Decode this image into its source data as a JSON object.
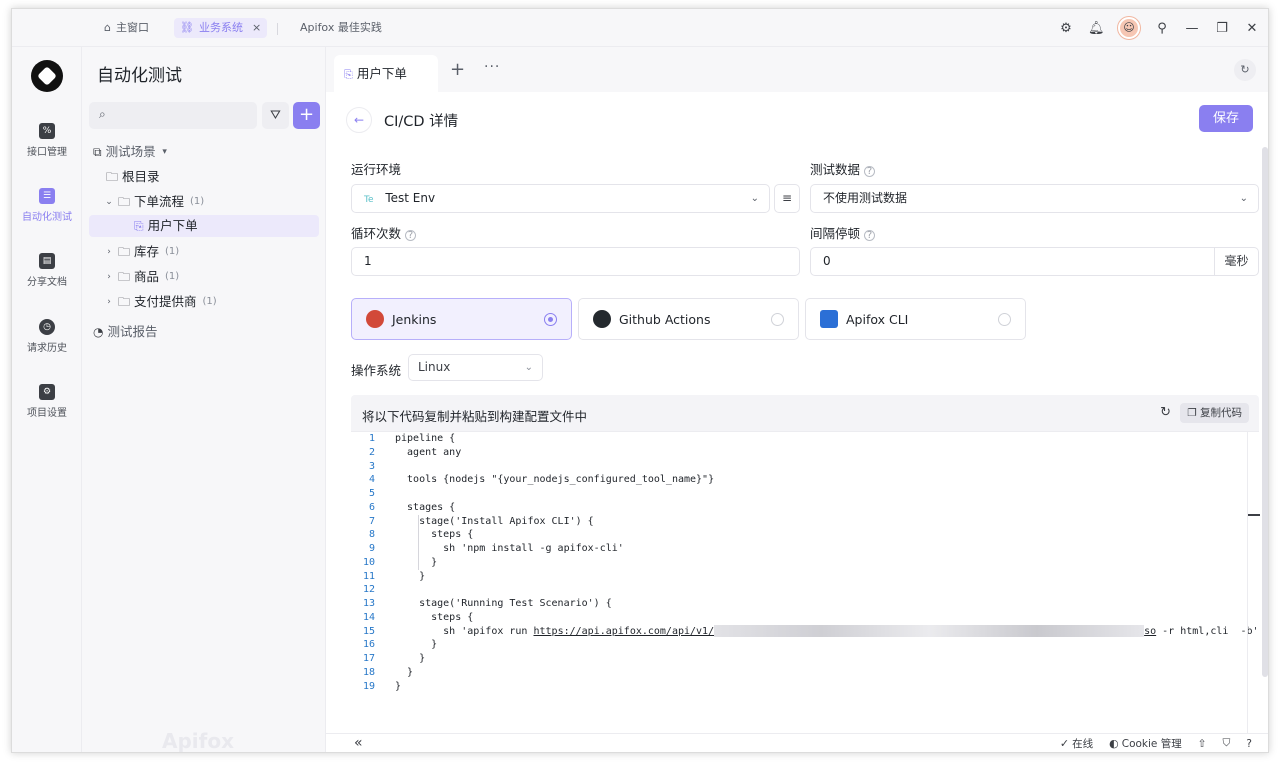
{
  "titlebar": {
    "tabs": [
      {
        "label": "主窗口",
        "icon": "home-icon"
      },
      {
        "label": "业务系统",
        "icon": "link-icon",
        "active": true
      },
      {
        "label": "Apifox 最佳实践",
        "icon": ""
      }
    ],
    "close_glyph": "×"
  },
  "rail": {
    "items": [
      {
        "label": "接口管理",
        "icon": "api-icon"
      },
      {
        "label": "自动化测试",
        "icon": "automation-icon",
        "active": true
      },
      {
        "label": "分享文档",
        "icon": "docs-icon"
      },
      {
        "label": "请求历史",
        "icon": "history-icon"
      },
      {
        "label": "项目设置",
        "icon": "settings-icon"
      }
    ]
  },
  "tree": {
    "title": "自动化测试",
    "search_placeholder": "",
    "root_label": "测试场景",
    "nodes": {
      "root": "根目录",
      "order_flow": {
        "label": "下单流程",
        "count": "(1)"
      },
      "user_order": "用户下单",
      "stock": {
        "label": "库存",
        "count": "(1)"
      },
      "goods": {
        "label": "商品",
        "count": "(1)"
      },
      "payment": {
        "label": "支付提供商",
        "count": "(1)"
      }
    },
    "report_label": "测试报告",
    "watermark": "Apifox"
  },
  "main": {
    "tab_label": "用户下单",
    "title": "CI/CD 详情",
    "save_label": "保存",
    "env_label": "运行环境",
    "env_chip": "Te",
    "env_value": "Test Env",
    "testdata_label": "测试数据",
    "testdata_value": "不使用测试数据",
    "loop_label": "循环次数",
    "loop_value": "1",
    "interval_label": "间隔停顿",
    "interval_value": "0",
    "interval_unit": "毫秒",
    "ci_options": [
      {
        "label": "Jenkins",
        "selected": true
      },
      {
        "label": "Github Actions",
        "selected": false
      },
      {
        "label": "Apifox CLI",
        "selected": false
      }
    ],
    "os_label": "操作系统",
    "os_value": "Linux",
    "code_header": "将以下代码复制并粘贴到构建配置文件中",
    "copy_label": "复制代码",
    "code": {
      "line_numbers": [
        "1",
        "2",
        "3",
        "4",
        "5",
        "6",
        "7",
        "8",
        "9",
        "10",
        "11",
        "12",
        "13",
        "14",
        "15",
        "16",
        "17",
        "18",
        "19"
      ],
      "l1": "pipeline {",
      "l2": "  agent any",
      "l3": "",
      "l4": "  tools {nodejs \"{your_nodejs_configured_tool_name}\"}",
      "l5": "",
      "l6": "  stages {",
      "l7": "    stage('Install Apifox CLI') {",
      "l8": "      steps {",
      "l9": "        sh 'npm install -g apifox-cli'",
      "l10": "      }",
      "l11": "    }",
      "l12": "",
      "l13": "    stage('Running Test Scenario') {",
      "l14": "      steps {",
      "l15_prefix": "        sh 'apifox run ",
      "l15_url": "https://api.apifox.com/api/v1/",
      "l15_url_tail": "so",
      "l15_suffix": " -r html,cli  -b'",
      "l16": "      }",
      "l17": "    }",
      "l18": "  }",
      "l19": "}"
    }
  },
  "statusbar": {
    "online": "在线",
    "cookie": "Cookie 管理"
  }
}
